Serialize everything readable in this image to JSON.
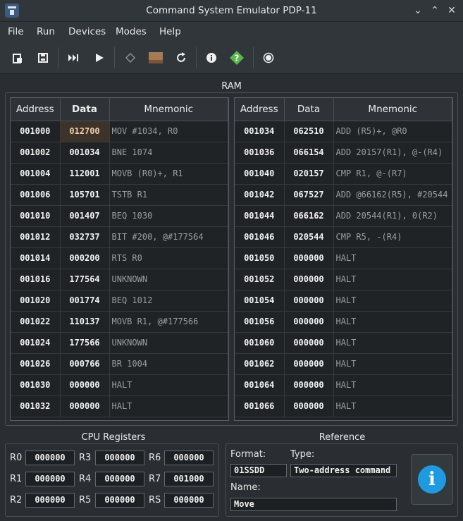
{
  "window": {
    "title": "Command System Emulator PDP-11"
  },
  "menu": {
    "items": [
      "File",
      "Run",
      "Devices",
      "Modes",
      "Help"
    ]
  },
  "toolbar": {
    "buttons": [
      {
        "icon": "open-file-icon"
      },
      {
        "icon": "save-icon"
      },
      {
        "icon": "step-forward-icon"
      },
      {
        "icon": "run-icon"
      },
      {
        "icon": "breakpoint-icon"
      },
      {
        "icon": "memory-chip-icon"
      },
      {
        "icon": "reset-icon"
      },
      {
        "icon": "info-icon"
      },
      {
        "icon": "help-icon"
      },
      {
        "icon": "record-icon"
      }
    ]
  },
  "ram": {
    "title": "RAM",
    "headers": {
      "address": "Address",
      "data": "Data",
      "mnemonic": "Mnemonic"
    },
    "left": [
      {
        "address": "001000",
        "data": "012700",
        "mnemonic": "MOV #1034, R0",
        "current": true
      },
      {
        "address": "001002",
        "data": "001034",
        "mnemonic": "BNE 1074"
      },
      {
        "address": "001004",
        "data": "112001",
        "mnemonic": "MOVB (R0)+, R1"
      },
      {
        "address": "001006",
        "data": "105701",
        "mnemonic": "TSTB R1"
      },
      {
        "address": "001010",
        "data": "001407",
        "mnemonic": "BEQ 1030"
      },
      {
        "address": "001012",
        "data": "032737",
        "mnemonic": "BIT #200, @#177564"
      },
      {
        "address": "001014",
        "data": "000200",
        "mnemonic": "RTS R0"
      },
      {
        "address": "001016",
        "data": "177564",
        "mnemonic": "UNKNOWN"
      },
      {
        "address": "001020",
        "data": "001774",
        "mnemonic": "BEQ 1012"
      },
      {
        "address": "001022",
        "data": "110137",
        "mnemonic": "MOVB R1, @#177566"
      },
      {
        "address": "001024",
        "data": "177566",
        "mnemonic": "UNKNOWN"
      },
      {
        "address": "001026",
        "data": "000766",
        "mnemonic": "BR 1004"
      },
      {
        "address": "001030",
        "data": "000000",
        "mnemonic": "HALT"
      },
      {
        "address": "001032",
        "data": "000000",
        "mnemonic": "HALT"
      }
    ],
    "right": [
      {
        "address": "001034",
        "data": "062510",
        "mnemonic": "ADD (R5)+, @R0"
      },
      {
        "address": "001036",
        "data": "066154",
        "mnemonic": "ADD 20157(R1), @-(R4)"
      },
      {
        "address": "001040",
        "data": "020157",
        "mnemonic": "CMP R1, @-(R7)"
      },
      {
        "address": "001042",
        "data": "067527",
        "mnemonic": "ADD @66162(R5), #20544"
      },
      {
        "address": "001044",
        "data": "066162",
        "mnemonic": "ADD 20544(R1), 0(R2)"
      },
      {
        "address": "001046",
        "data": "020544",
        "mnemonic": "CMP R5, -(R4)"
      },
      {
        "address": "001050",
        "data": "000000",
        "mnemonic": "HALT"
      },
      {
        "address": "001052",
        "data": "000000",
        "mnemonic": "HALT"
      },
      {
        "address": "001054",
        "data": "000000",
        "mnemonic": "HALT"
      },
      {
        "address": "001056",
        "data": "000000",
        "mnemonic": "HALT"
      },
      {
        "address": "001060",
        "data": "000000",
        "mnemonic": "HALT"
      },
      {
        "address": "001062",
        "data": "000000",
        "mnemonic": "HALT"
      },
      {
        "address": "001064",
        "data": "000000",
        "mnemonic": "HALT"
      },
      {
        "address": "001066",
        "data": "000000",
        "mnemonic": "HALT"
      }
    ]
  },
  "cpu": {
    "title": "CPU Registers",
    "registers": [
      {
        "name": "R0",
        "value": "000000"
      },
      {
        "name": "R3",
        "value": "000000"
      },
      {
        "name": "R6",
        "value": "000000"
      },
      {
        "name": "R1",
        "value": "000000"
      },
      {
        "name": "R4",
        "value": "000000"
      },
      {
        "name": "R7",
        "value": "001000"
      },
      {
        "name": "R2",
        "value": "000000"
      },
      {
        "name": "R5",
        "value": "000000"
      },
      {
        "name": "RS",
        "value": "000000"
      }
    ]
  },
  "reference": {
    "title": "Reference",
    "format_label": "Format:",
    "format_value": "01SSDD",
    "type_label": "Type:",
    "type_value": "Two-address command",
    "name_label": "Name:",
    "name_value": "Move",
    "info_icon": "info-icon"
  }
}
